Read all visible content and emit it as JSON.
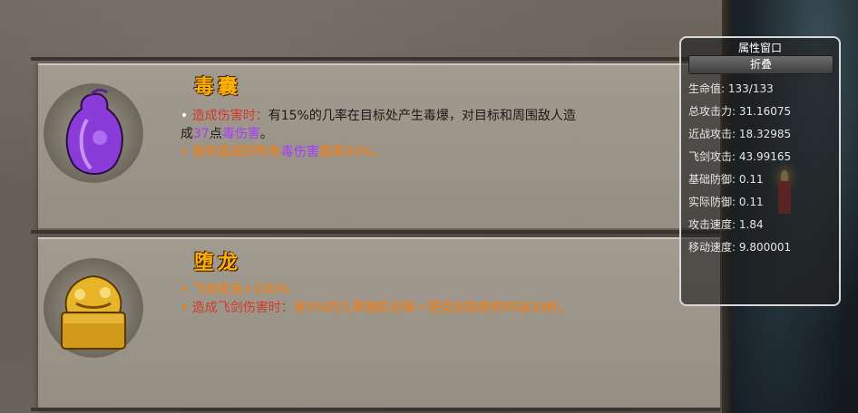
{
  "attributes": {
    "title": "属性窗口",
    "collapse_label": "折叠",
    "stats": [
      {
        "label": "生命值:",
        "value": "133/133"
      },
      {
        "label": "总攻击力:",
        "value": "31.16075"
      },
      {
        "label": "近战攻击:",
        "value": "18.32985"
      },
      {
        "label": "飞剑攻击:",
        "value": "43.99165"
      },
      {
        "label": "基础防御:",
        "value": "0.11"
      },
      {
        "label": "实际防御:",
        "value": "0.11"
      },
      {
        "label": "攻击速度:",
        "value": "1.84"
      },
      {
        "label": "移动速度:",
        "value": "9.800001"
      }
    ]
  },
  "items": [
    {
      "name": "毒囊",
      "icon": "poison-sac-icon",
      "lines": [
        {
          "bullet": "•",
          "label": "造成伤害时：",
          "text": "有15%的几率在目标处产生毒爆，对目标和周围敌人造"
        },
        {
          "pre": "成",
          "num": "37",
          "mid": "点",
          "em": "毒伤害",
          "post": "。"
        },
        {
          "bullet": "•",
          "pre": "使你造成的所有",
          "em": "毒伤害",
          "post": "提高30%。"
        }
      ]
    },
    {
      "name": "堕龙",
      "icon": "dragon-seal-icon",
      "lines": [
        {
          "bullet": "•",
          "text": "飞剑攻击+100%"
        },
        {
          "bullet": "•",
          "label": "造成飞剑伤害时：",
          "text": "有5%的几率随机召唤一把圣剑协助你作战30秒。"
        }
      ]
    }
  ]
}
